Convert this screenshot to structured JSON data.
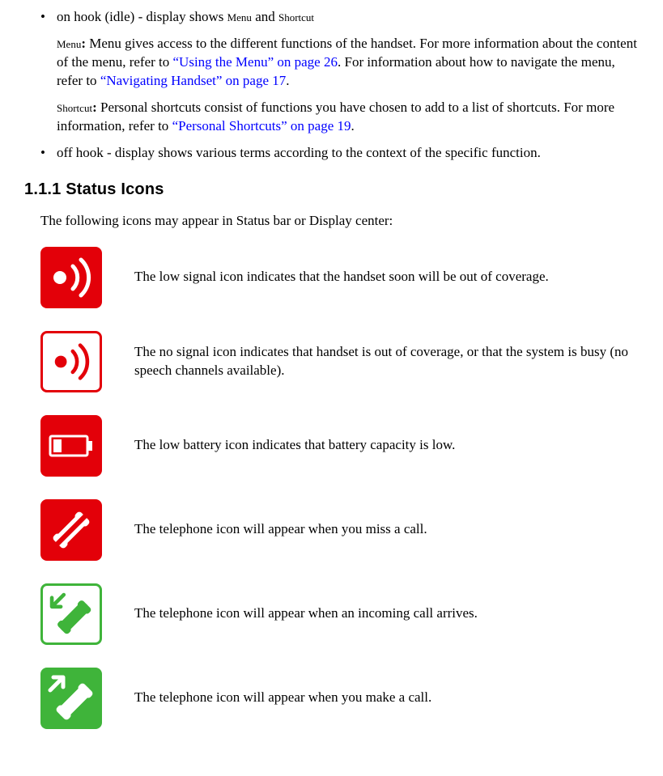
{
  "bullets": {
    "onhook": {
      "prefix": "on hook (idle) - display shows ",
      "label1": "Menu",
      "and": " and ",
      "label2": "Shortcut"
    },
    "menu_para": {
      "label": "Menu",
      "colon": ": ",
      "text1": "Menu gives access to the different functions of the handset. For more information about the content of the menu, refer to ",
      "link1": "“Using the Menu” on page 26",
      "text2": ". For information about how to navigate the menu, refer to ",
      "link2": "“Navigating Handset” on page 17",
      "text3": "."
    },
    "shortcut_para": {
      "label": "Shortcut",
      "colon": ": ",
      "text1": "Personal shortcuts consist of functions you have chosen to add to a list of shortcuts. For more information, refer to ",
      "link1": "“Personal Shortcuts” on page 19",
      "text2": "."
    },
    "offhook": "off hook - display shows various terms according to the context of the specific function."
  },
  "section_heading": "1.1.1  Status Icons",
  "section_intro": "The following icons may appear in Status bar or Display center:",
  "icons": {
    "low_signal": "The low signal icon indicates that the handset soon will be out of coverage.",
    "no_signal": "The no signal icon indicates that handset is out of coverage, or that the system is busy (no speech channels available).",
    "low_battery": "The low battery icon indicates that battery capacity is low.",
    "missed_call": "The telephone icon will appear when you miss a call.",
    "incoming_call": "The telephone icon will appear when an incoming call arrives.",
    "outgoing_call": "The telephone icon will appear when you make a call."
  }
}
